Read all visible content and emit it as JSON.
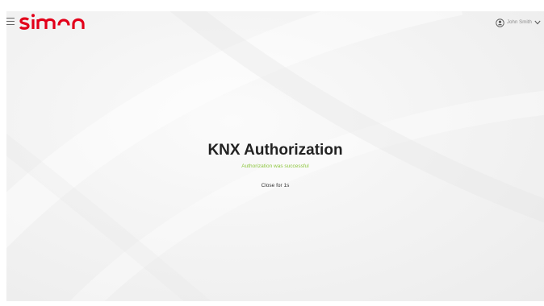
{
  "header": {
    "brand": "simon",
    "brand_color": "#e2001a",
    "user_name": "John Smith",
    "icons": [
      "menu-icon",
      "user-circle-icon",
      "chevron-down-icon"
    ]
  },
  "main": {
    "title": "KNX Authorization",
    "status_message": "Authorization was successful",
    "status_color": "#8dc63f",
    "countdown_text": "Close for 1s"
  }
}
